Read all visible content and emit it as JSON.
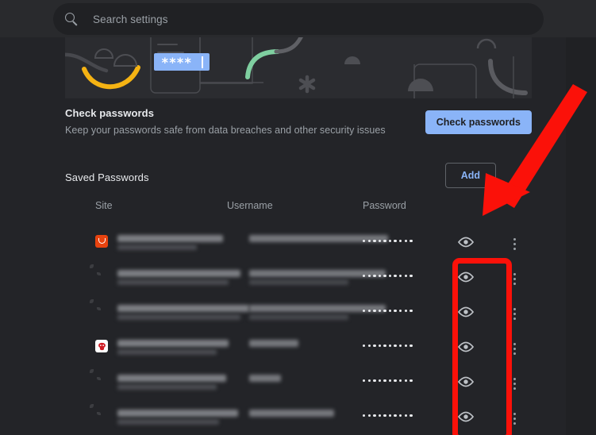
{
  "search": {
    "placeholder": "Search settings",
    "icon": "search-icon"
  },
  "hero": {
    "password_field_text": "****",
    "icon": "password-illustration"
  },
  "check_passwords": {
    "title": "Check passwords",
    "subtitle": "Keep your passwords safe from data breaches and other security issues",
    "button_label": "Check passwords",
    "button_color": "#8ab4f8"
  },
  "saved_passwords": {
    "title": "Saved Passwords",
    "add_label": "Add",
    "add_color": "#8ab4f8",
    "more_icon": "kebab-menu-icon"
  },
  "table": {
    "columns": [
      "Site",
      "Username",
      "Password"
    ],
    "rows": [
      {
        "favicon": "orange-app-icon",
        "site": "",
        "username": "",
        "password_mask": "••••••••••",
        "site_width": 133,
        "site_sub_width": 100,
        "user_width": 175,
        "user_sub_width": 0,
        "dots": 10,
        "show_icon": "eye-icon",
        "more_icon": "kebab-menu-icon"
      },
      {
        "favicon": "globe-icon",
        "site": "",
        "username": "",
        "password_mask": "••••••••••",
        "site_width": 155,
        "site_sub_width": 140,
        "user_width": 172,
        "user_sub_width": 125,
        "dots": 10,
        "show_icon": "eye-icon",
        "more_icon": "kebab-menu-icon"
      },
      {
        "favicon": "globe-icon",
        "site": "",
        "username": "",
        "password_mask": "••••••••••",
        "site_width": 166,
        "site_sub_width": 155,
        "user_width": 172,
        "user_sub_width": 125,
        "dots": 10,
        "show_icon": "eye-icon",
        "more_icon": "kebab-menu-icon"
      },
      {
        "favicon": "red-shield-icon",
        "site": "",
        "username": "",
        "password_mask": "••••••••••",
        "site_width": 140,
        "site_sub_width": 125,
        "user_width": 62,
        "user_sub_width": 0,
        "dots": 10,
        "show_icon": "eye-icon",
        "more_icon": "kebab-menu-icon"
      },
      {
        "favicon": "globe-icon",
        "site": "",
        "username": "",
        "password_mask": "••••••••••",
        "site_width": 137,
        "site_sub_width": 125,
        "user_width": 40,
        "user_sub_width": 0,
        "dots": 10,
        "show_icon": "eye-icon",
        "more_icon": "kebab-menu-icon"
      },
      {
        "favicon": "globe-icon",
        "site": "",
        "username": "",
        "password_mask": "••••••••••",
        "site_width": 152,
        "site_sub_width": 128,
        "user_width": 107,
        "user_sub_width": 0,
        "dots": 10,
        "show_icon": "eye-icon",
        "more_icon": "kebab-menu-icon"
      }
    ]
  },
  "annotations": {
    "highlight_color": "#fb1109",
    "box_target": "show-password-column",
    "arrow_target": "show-password-column"
  }
}
